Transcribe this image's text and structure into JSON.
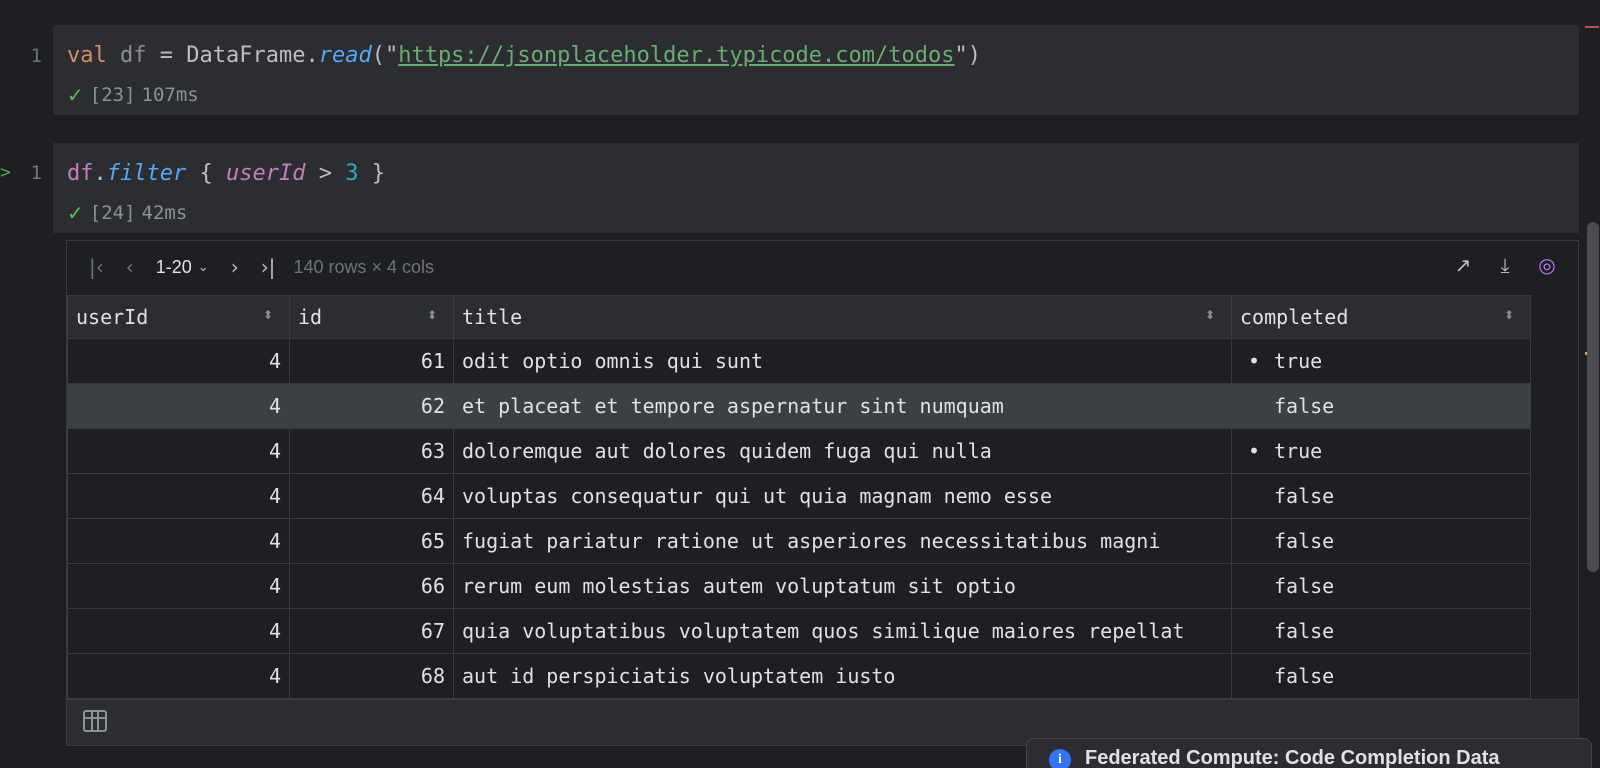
{
  "cells": [
    {
      "line_number": "1",
      "code": {
        "keyword": "val",
        "var": "df",
        "op": " = ",
        "cls": "DataFrame",
        "dot": ".",
        "method": "read",
        "open": "(\"",
        "url": "https://jsonplaceholder.typicode.com/todos",
        "close": "\")"
      },
      "exec_count": "[23]",
      "exec_time": "107ms"
    },
    {
      "line_number": "1",
      "code": {
        "var": "df",
        "dot": ".",
        "method": "filter",
        "open": " { ",
        "param": "userId",
        "op": " > ",
        "num": "3",
        "close": " }"
      },
      "exec_count": "[24]",
      "exec_time": "42ms"
    }
  ],
  "toolbar": {
    "first_icon": "first-page-icon",
    "prev_icon": "previous-page-icon",
    "page_range": "1-20",
    "next_icon": "next-page-icon",
    "last_icon": "last-page-icon",
    "row_count": "140 rows × 4 cols",
    "right_icons": [
      "open-external-icon",
      "download-icon",
      "kotlin-notebook-icon"
    ]
  },
  "table": {
    "columns": [
      "userId",
      "id",
      "title",
      "completed"
    ],
    "rows": [
      {
        "userId": "4",
        "id": "61",
        "title": "odit optio omnis qui sunt",
        "completed": "true"
      },
      {
        "userId": "4",
        "id": "62",
        "title": "et placeat et tempore aspernatur sint numquam",
        "completed": "false"
      },
      {
        "userId": "4",
        "id": "63",
        "title": "doloremque aut dolores quidem fuga qui nulla",
        "completed": "true"
      },
      {
        "userId": "4",
        "id": "64",
        "title": "voluptas consequatur qui ut quia magnam nemo esse",
        "completed": "false"
      },
      {
        "userId": "4",
        "id": "65",
        "title": "fugiat pariatur ratione ut asperiores necessitatibus magni",
        "completed": "false"
      },
      {
        "userId": "4",
        "id": "66",
        "title": "rerum eum molestias autem voluptatum sit optio",
        "completed": "false"
      },
      {
        "userId": "4",
        "id": "67",
        "title": "quia voluptatibus voluptatem quos similique maiores repellat",
        "completed": "false"
      },
      {
        "userId": "4",
        "id": "68",
        "title": "aut id perspiciatis voluptatem iusto",
        "completed": "false"
      }
    ],
    "selected_row_index": 1
  },
  "notification": {
    "title": "Federated Compute: Code Completion Data"
  },
  "colors": {
    "editor_bg": "#1e1f22",
    "cell_bg": "#2b2d30",
    "keyword": "#cf8e6d",
    "string": "#6aab73",
    "method": "#56a8f5",
    "number": "#2aacb8",
    "param": "#c77dbb",
    "success": "#5fb85b",
    "info": "#3574f0"
  }
}
